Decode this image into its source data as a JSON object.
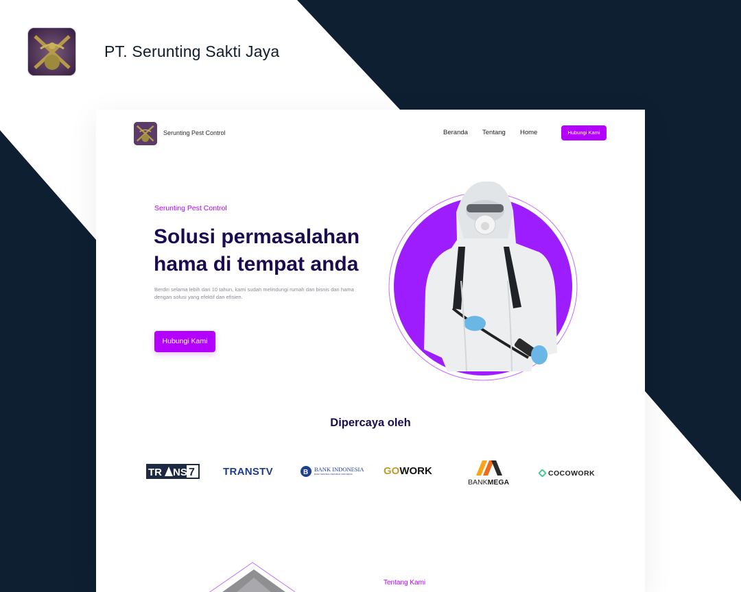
{
  "header": {
    "company_name": "PT. Serunting Sakti Jaya"
  },
  "nav": {
    "brand": "Serunting Pest Control",
    "links": [
      "Beranda",
      "Tentang",
      "Home"
    ],
    "cta": "Hubungi Kami"
  },
  "hero": {
    "eyebrow": "Serunting Pest Control",
    "title_line1": "Solusi permasalahan",
    "title_line2": "hama di tempat anda",
    "description": "Berdiri selama lebih dari 10 tahun, kami sudah melindungi rumah dan bisnis dari hama dengan solusi yang efektif dan efisien.",
    "cta": "Hubungi Kami"
  },
  "trusted": {
    "heading": "Dipercaya oleh",
    "logos": {
      "trans7_a": "TR",
      "trans7_b": "NS",
      "trans7_c": "7",
      "transtv": "TRANSTV",
      "bi_main": "BANK INDONESIA",
      "bi_sub": "BANK SENTRAL REPUBLIK INDONESIA",
      "gowork_go": "GO",
      "gowork_work": "WORK",
      "bankmega_a": "BANK",
      "bankmega_b": "MEGA",
      "cocowork": "COCOWORK"
    }
  },
  "about": {
    "eyebrow": "Tentang Kami"
  },
  "colors": {
    "accent": "#b400ff",
    "navy": "#0d1f30",
    "heading": "#1c0b4f"
  }
}
